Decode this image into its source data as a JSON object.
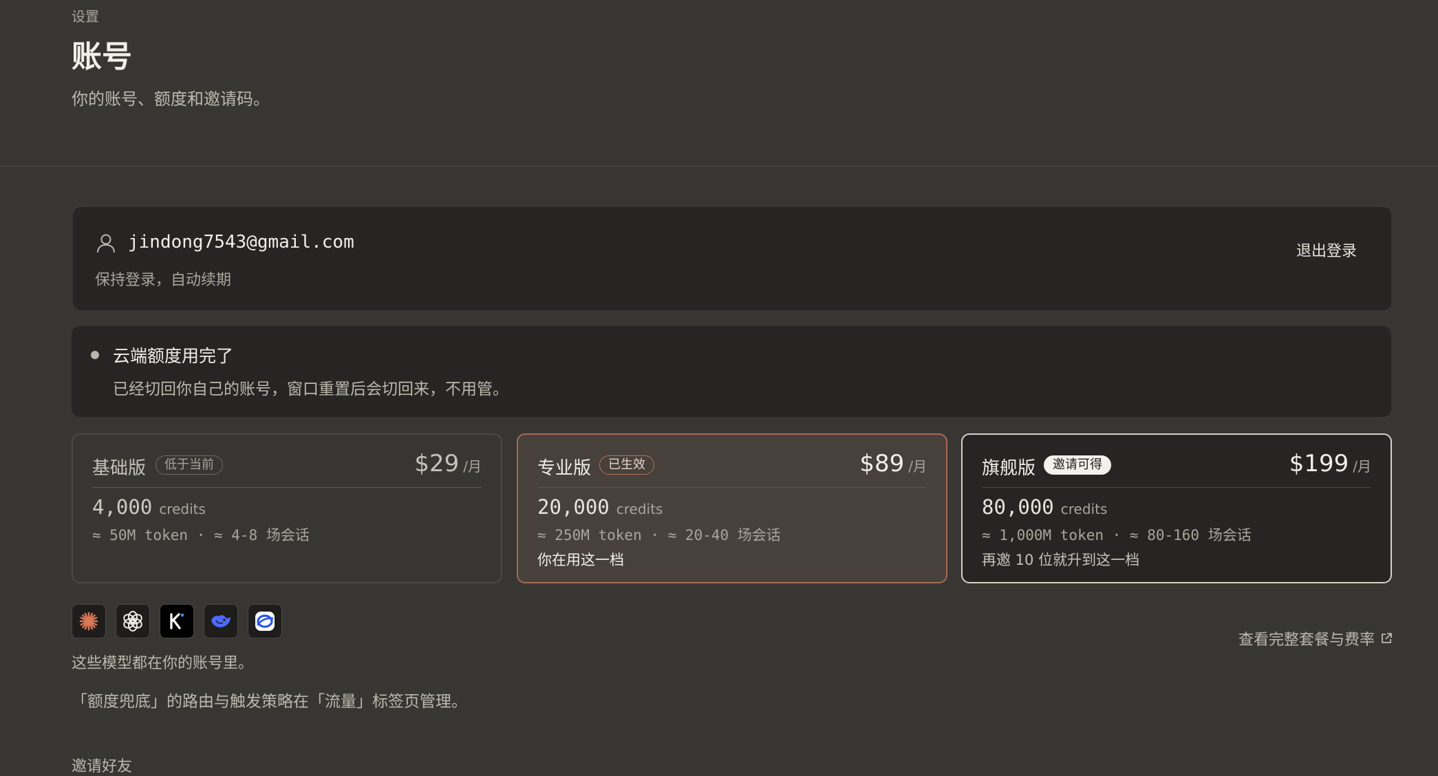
{
  "header": {
    "breadcrumb": "设置",
    "title": "账号",
    "subtitle": "你的账号、额度和邀请码。"
  },
  "account": {
    "email": "jindong7543@gmail.com",
    "status": "保持登录，自动续期",
    "logout_label": "退出登录",
    "icon": "user-icon"
  },
  "alert": {
    "title": "云端额度用完了",
    "description": "已经切回你自己的账号，窗口重置后会切回来，不用管。"
  },
  "plans": [
    {
      "name": "基础版",
      "badge": "低于当前",
      "price": "$29",
      "per": "/月",
      "credits": "4,000",
      "credits_unit": "credits",
      "token_line": "≈ 50M token · ≈ 4-8 场会话",
      "note": ""
    },
    {
      "name": "专业版",
      "badge": "已生效",
      "price": "$89",
      "per": "/月",
      "credits": "20,000",
      "credits_unit": "credits",
      "token_line": "≈ 250M token · ≈ 20-40 场会话",
      "note": "你在用这一档"
    },
    {
      "name": "旗舰版",
      "badge": "邀请可得",
      "price": "$199",
      "per": "/月",
      "credits": "80,000",
      "credits_unit": "credits",
      "token_line": "≈ 1,000M token · ≈ 80-160 场会话",
      "note": "再邀 10 位就升到这一档"
    }
  ],
  "models": {
    "icons": [
      "claude-icon",
      "openai-icon",
      "kimi-icon",
      "deepseek-icon",
      "doubao-icon"
    ],
    "note": "这些模型都在你的账号里。"
  },
  "routing_note": "「额度兜底」的路由与触发策略在「流量」标签页管理。",
  "full_plans_link": "查看完整套餐与费率",
  "invite_heading": "邀请好友",
  "colors": {
    "background": "#383633",
    "card": "#262524",
    "active_border": "#a66b55",
    "flag_border": "#d6d2ca"
  }
}
